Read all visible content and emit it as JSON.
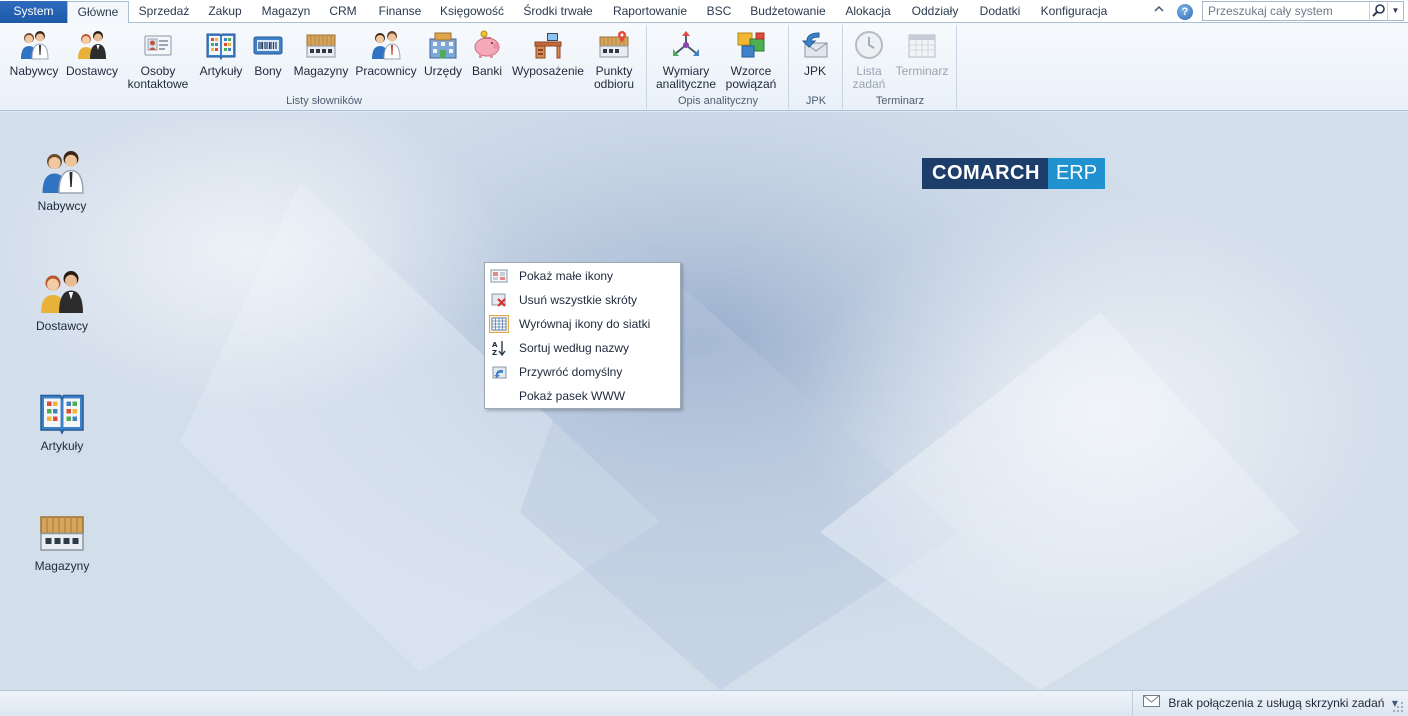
{
  "menu": {
    "tabs": [
      {
        "label": "System"
      },
      {
        "label": "Główne"
      },
      {
        "label": "Sprzedaż"
      },
      {
        "label": "Zakup"
      },
      {
        "label": "Magazyn"
      },
      {
        "label": "CRM"
      },
      {
        "label": "Finanse"
      },
      {
        "label": "Księgowość"
      },
      {
        "label": "Środki trwałe"
      },
      {
        "label": "Raportowanie"
      },
      {
        "label": "BSC"
      },
      {
        "label": "Budżetowanie"
      },
      {
        "label": "Alokacja"
      },
      {
        "label": "Oddziały"
      },
      {
        "label": "Dodatki"
      },
      {
        "label": "Konfiguracja"
      }
    ],
    "active_tab": "Główne",
    "collapse_icon": "chevron-up-icon",
    "help_icon": "help-icon",
    "help_glyph": "?"
  },
  "search": {
    "placeholder": "Przeszukaj cały system",
    "icon": "magnifier-icon",
    "dropdown_glyph": "▼"
  },
  "ribbon": {
    "groups": [
      {
        "label": "Listy słowników"
      },
      {
        "label": "Opis analityczny"
      },
      {
        "label": "JPK"
      },
      {
        "label": "Terminarz"
      }
    ],
    "buttons": [
      {
        "label": "Nabywcy",
        "icon": "people-icon"
      },
      {
        "label": "Dostawcy",
        "icon": "people-icon"
      },
      {
        "label": "Osoby\nkontaktowe",
        "icon": "contact-card-icon"
      },
      {
        "label": "Artykuły",
        "icon": "book-icon"
      },
      {
        "label": "Bony",
        "icon": "voucher-icon"
      },
      {
        "label": "Magazyny",
        "icon": "warehouse-icon"
      },
      {
        "label": "Pracownicy",
        "icon": "people-icon"
      },
      {
        "label": "Urzędy",
        "icon": "building-icon"
      },
      {
        "label": "Banki",
        "icon": "piggy-bank-icon"
      },
      {
        "label": "Wyposażenie",
        "icon": "desk-icon"
      },
      {
        "label": "Punkty\nodbioru",
        "icon": "pickup-point-icon"
      },
      {
        "label": "Wymiary\nanalityczne",
        "icon": "dimensions-icon"
      },
      {
        "label": "Wzorce\npowiązań",
        "icon": "patterns-icon"
      },
      {
        "label": "JPK",
        "icon": "jpk-icon"
      },
      {
        "label": "Lista\nzadań",
        "icon": "clock-icon",
        "disabled": true
      },
      {
        "label": "Terminarz",
        "icon": "calendar-icon",
        "disabled": true
      }
    ]
  },
  "desktop": {
    "shortcuts": [
      {
        "label": "Nabywcy",
        "icon": "people-icon"
      },
      {
        "label": "Dostawcy",
        "icon": "people-icon"
      },
      {
        "label": "Artykuły",
        "icon": "book-icon"
      },
      {
        "label": "Magazyny",
        "icon": "warehouse-icon"
      }
    ],
    "logo": {
      "left": "COMARCH",
      "right": "ERP"
    }
  },
  "context_menu": {
    "items": [
      {
        "label": "Pokaż małe ikony",
        "icon": "small-icons-icon"
      },
      {
        "label": "Usuń wszystkie skróty",
        "icon": "delete-shortcuts-icon"
      },
      {
        "label": "Wyrównaj ikony do siatki",
        "icon": "grid-icon"
      },
      {
        "label": "Sortuj według nazwy",
        "icon": "sort-az-icon"
      },
      {
        "label": "Przywróć domyślny",
        "icon": "restore-icon"
      },
      {
        "label": "Pokaż pasek WWW",
        "icon": ""
      }
    ]
  },
  "status": {
    "message": "Brak połączenia z usługą skrzynki zadań",
    "icon": "envelope-icon",
    "dropdown_glyph": "▾"
  },
  "colors": {
    "system_tab": "#1c5aa8",
    "logo_dark": "#1d3d6b",
    "logo_light": "#2192d0",
    "desktop_bg": "#d3deeb"
  }
}
